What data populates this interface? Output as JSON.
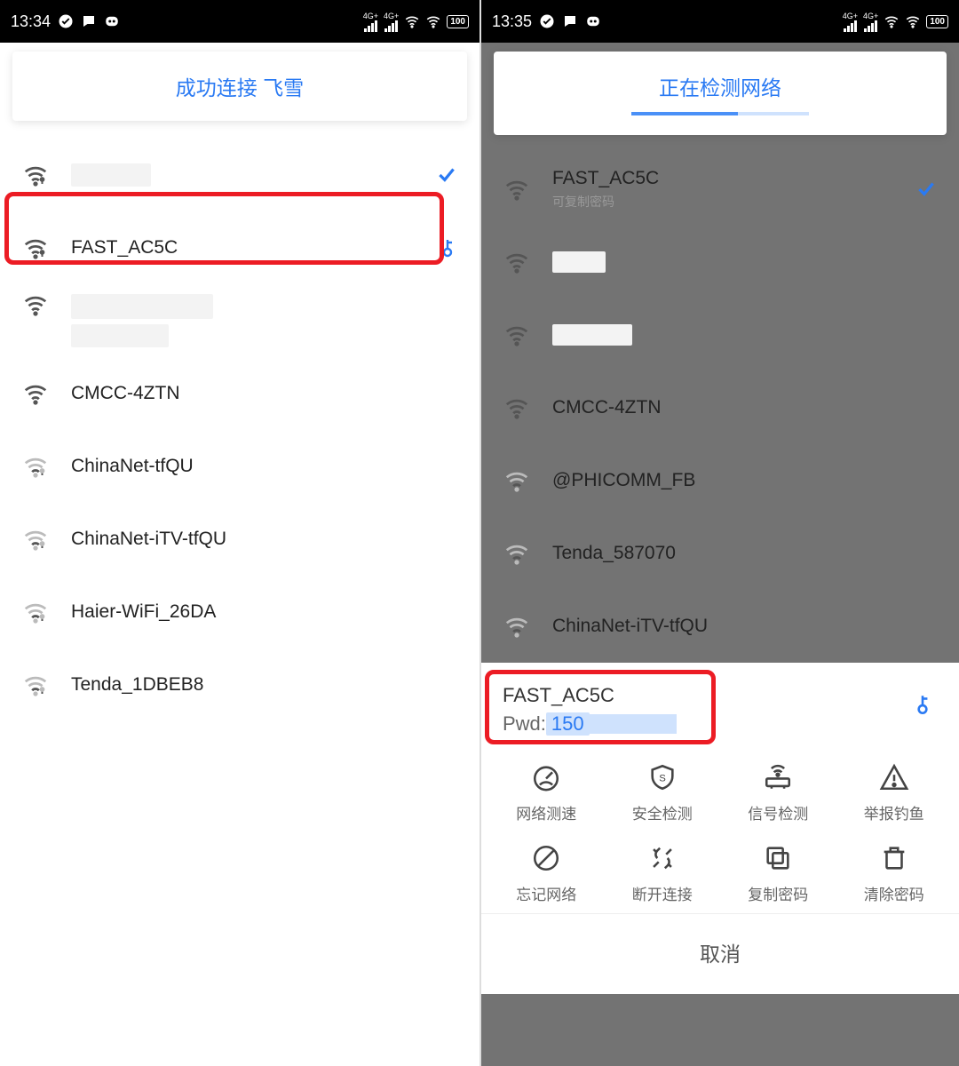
{
  "colors": {
    "accent": "#2a7af3",
    "highlight_red": "#ec1c24"
  },
  "left": {
    "status": {
      "time": "13:34",
      "net1_label": "4G+",
      "net2_label": "4G+",
      "battery": "100"
    },
    "banner": "成功连接 飞雪",
    "networks": [
      {
        "label": "",
        "signal": "strong",
        "connected": true,
        "key": false
      },
      {
        "label": "FAST_AC5C",
        "signal": "strong",
        "connected": false,
        "key": true
      },
      {
        "label": "",
        "signal": "strong",
        "redacted_two_line": true
      },
      {
        "label": "CMCC-4ZTN",
        "signal": "strong"
      },
      {
        "label": "ChinaNet-tfQU",
        "signal": "weak"
      },
      {
        "label": "ChinaNet-iTV-tfQU",
        "signal": "weak"
      },
      {
        "label": "Haier-WiFi_26DA",
        "signal": "weak"
      },
      {
        "label": "Tenda_1DBEB8",
        "signal": "weak"
      }
    ]
  },
  "right": {
    "status": {
      "time": "13:35",
      "net1_label": "4G+",
      "net2_label": "4G+",
      "battery": "100"
    },
    "banner": "正在检测网络",
    "networks": [
      {
        "label": "FAST_AC5C",
        "sub": "可复制密码",
        "connected": true,
        "signal": "strong"
      },
      {
        "label": "",
        "redacted": true,
        "signal": "strong"
      },
      {
        "label": "",
        "redacted": true,
        "signal": "strong"
      },
      {
        "label": "CMCC-4ZTN",
        "signal": "strong"
      },
      {
        "label": "@PHICOMM_FB",
        "signal": "weak"
      },
      {
        "label": "Tenda_587070",
        "signal": "weak"
      },
      {
        "label": "ChinaNet-iTV-tfQU",
        "signal": "weak"
      }
    ],
    "sheet": {
      "name": "FAST_AC5C",
      "pwd_label": "Pwd:",
      "pwd_value": "150",
      "actions": [
        {
          "id": "speed",
          "label": "网络测速"
        },
        {
          "id": "safety",
          "label": "安全检测"
        },
        {
          "id": "signal",
          "label": "信号检测"
        },
        {
          "id": "report",
          "label": "举报钓鱼"
        },
        {
          "id": "forget",
          "label": "忘记网络"
        },
        {
          "id": "disc",
          "label": "断开连接"
        },
        {
          "id": "copy",
          "label": "复制密码"
        },
        {
          "id": "clear",
          "label": "清除密码"
        }
      ],
      "cancel": "取消"
    }
  }
}
